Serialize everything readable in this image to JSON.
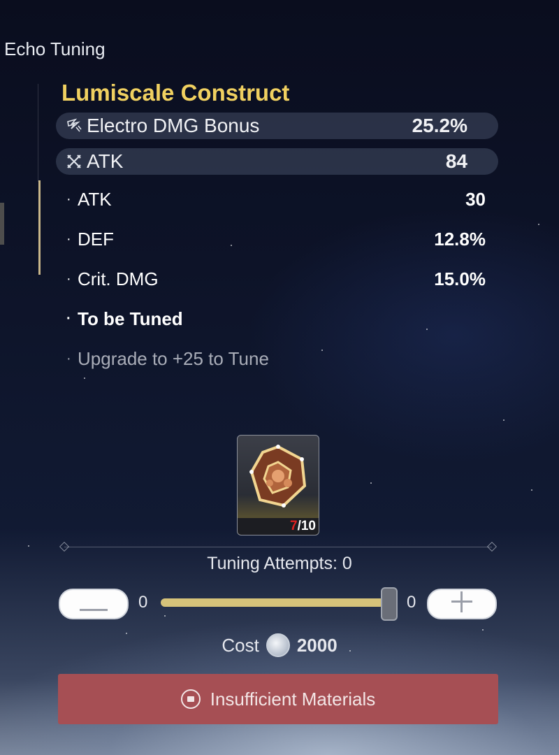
{
  "screen": {
    "title": "Echo Tuning"
  },
  "echo": {
    "name": "Lumiscale Construct",
    "main_stats": [
      {
        "icon": "electro-dmg-icon",
        "name": "Electro DMG Bonus",
        "value": "25.2%"
      },
      {
        "icon": "crossed-swords-icon",
        "name": "ATK",
        "value": "84"
      }
    ],
    "sub_stats": [
      {
        "name": "ATK",
        "value": "30"
      },
      {
        "name": "DEF",
        "value": "12.8%"
      },
      {
        "name": "Crit. DMG",
        "value": "15.0%"
      }
    ],
    "to_be_tuned": "To be Tuned",
    "upgrade_hint": "Upgrade to +25 to Tune"
  },
  "material": {
    "icon": "tuner-crystal-icon",
    "owned": "7",
    "required": "/10"
  },
  "tuning": {
    "attempts_label": "Tuning Attempts: 0",
    "min_value": "0",
    "max_value": "0"
  },
  "cost": {
    "label": "Cost",
    "amount": "2000",
    "icon": "shell-credit-icon"
  },
  "action_button": {
    "label": "Insufficient Materials",
    "icon": "lock-icon",
    "color": "#a64f54"
  },
  "colors": {
    "echo_name": "#f0d060",
    "owned_count": "#e02020",
    "slider_fill": "#d6c37a"
  }
}
